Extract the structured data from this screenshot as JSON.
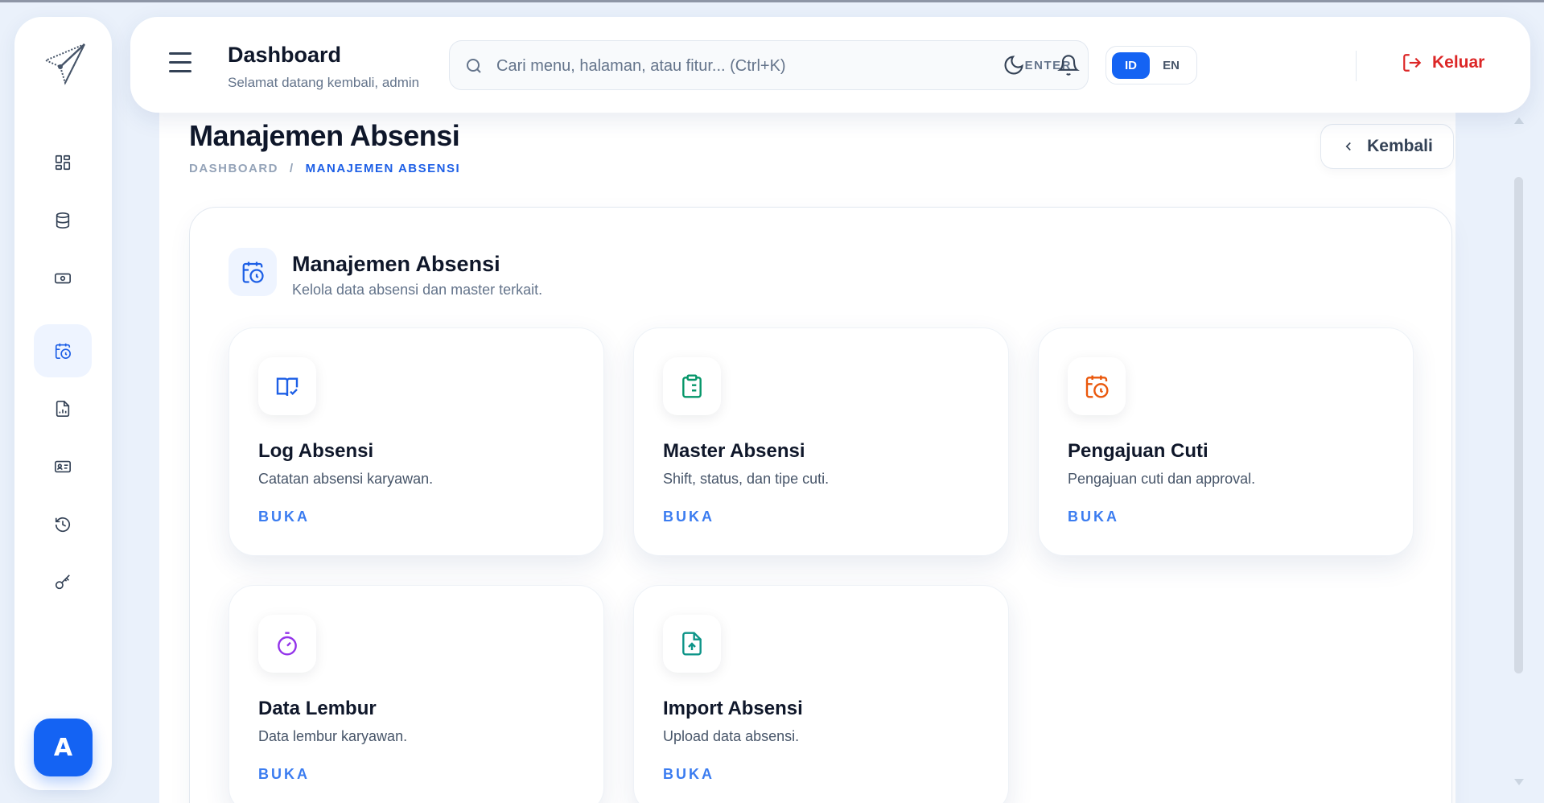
{
  "header": {
    "title": "Dashboard",
    "subtitle": "Selamat datang kembali, admin",
    "search_placeholder": "Cari menu, halaman, atau fitur... (Ctrl+K)",
    "search_hint": "ENTER",
    "lang_active": "ID",
    "lang_other": "EN",
    "logout_label": "Keluar"
  },
  "sidebar": {
    "items": [
      {
        "icon": "grid-icon",
        "active": false
      },
      {
        "icon": "database-icon",
        "active": false
      },
      {
        "icon": "money-icon",
        "active": false
      },
      {
        "icon": "calendar-clock-icon",
        "active": true
      },
      {
        "icon": "report-icon",
        "active": false
      },
      {
        "icon": "id-card-icon",
        "active": false
      },
      {
        "icon": "history-icon",
        "active": false
      },
      {
        "icon": "key-icon",
        "active": false
      }
    ],
    "avatar_initial": "A"
  },
  "page": {
    "title": "Manajemen Absensi",
    "breadcrumb": [
      "DASHBOARD",
      "/",
      "MANAJEMEN ABSENSI"
    ],
    "back_label": "Kembali"
  },
  "section": {
    "title": "Manajemen Absensi",
    "subtitle": "Kelola data absensi dan master terkait."
  },
  "cards": [
    {
      "title": "Log Absensi",
      "desc": "Catatan absensi karyawan.",
      "link": "BUKA",
      "icon": "book-check-icon",
      "color": "#1d5fe6"
    },
    {
      "title": "Master Absensi",
      "desc": "Shift, status, dan tipe cuti.",
      "link": "BUKA",
      "icon": "clipboard-list-icon",
      "color": "#059669"
    },
    {
      "title": "Pengajuan Cuti",
      "desc": "Pengajuan cuti dan approval.",
      "link": "BUKA",
      "icon": "calendar-clock-icon",
      "color": "#ea580c"
    },
    {
      "title": "Data Lembur",
      "desc": "Data lembur karyawan.",
      "link": "BUKA",
      "icon": "stopwatch-icon",
      "color": "#9333ea"
    },
    {
      "title": "Import Absensi",
      "desc": "Upload data absensi.",
      "link": "BUKA",
      "icon": "file-upload-icon",
      "color": "#0d9488"
    }
  ]
}
